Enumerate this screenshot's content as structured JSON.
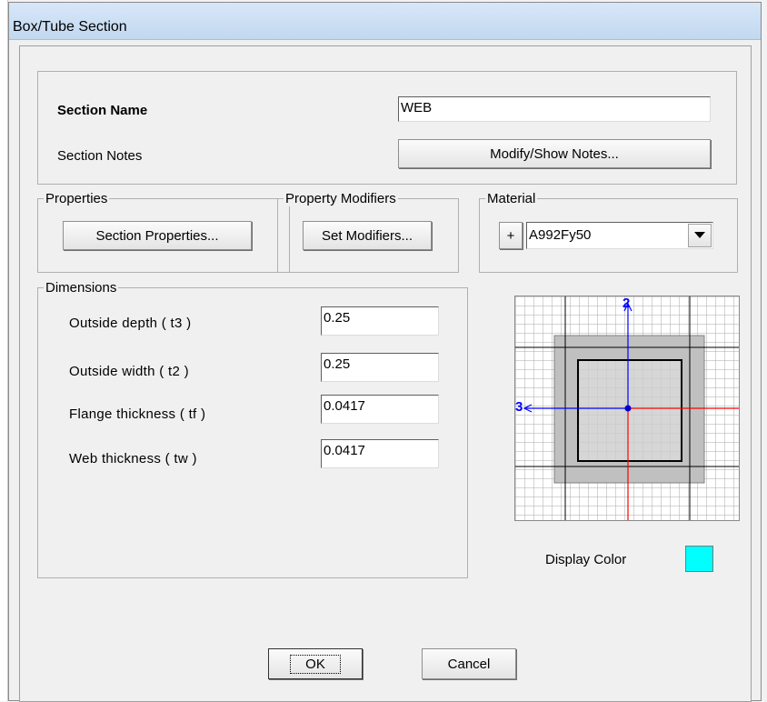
{
  "window": {
    "title": "Box/Tube Section"
  },
  "section": {
    "name_label": "Section Name",
    "name_value": "WEB",
    "notes_label": "Section Notes",
    "notes_button": "Modify/Show Notes..."
  },
  "properties": {
    "legend": "Properties",
    "button": "Section Properties..."
  },
  "modifiers": {
    "legend": "Property Modifiers",
    "button": "Set Modifiers..."
  },
  "material": {
    "legend": "Material",
    "plus_button": "+",
    "selected": "A992Fy50"
  },
  "dimensions": {
    "legend": "Dimensions",
    "rows": [
      {
        "label": "Outside depth  ( t3 )",
        "value": "0.25"
      },
      {
        "label": "Outside width  ( t2 )",
        "value": "0.25"
      },
      {
        "label": "Flange thickness  ( tf )",
        "value": "0.0417"
      },
      {
        "label": "Web thickness  ( tw )",
        "value": "0.0417"
      }
    ]
  },
  "preview": {
    "axis_2": "2",
    "axis_3": "3"
  },
  "display_color": {
    "label": "Display Color",
    "color": "#00ffff"
  },
  "buttons": {
    "ok": "OK",
    "cancel": "Cancel"
  },
  "colors": {
    "title_bar": "#c9dcf2",
    "axis_blue": "#0000ff",
    "axis_red": "#ff0000",
    "section_fill": "#c0c0c0"
  }
}
